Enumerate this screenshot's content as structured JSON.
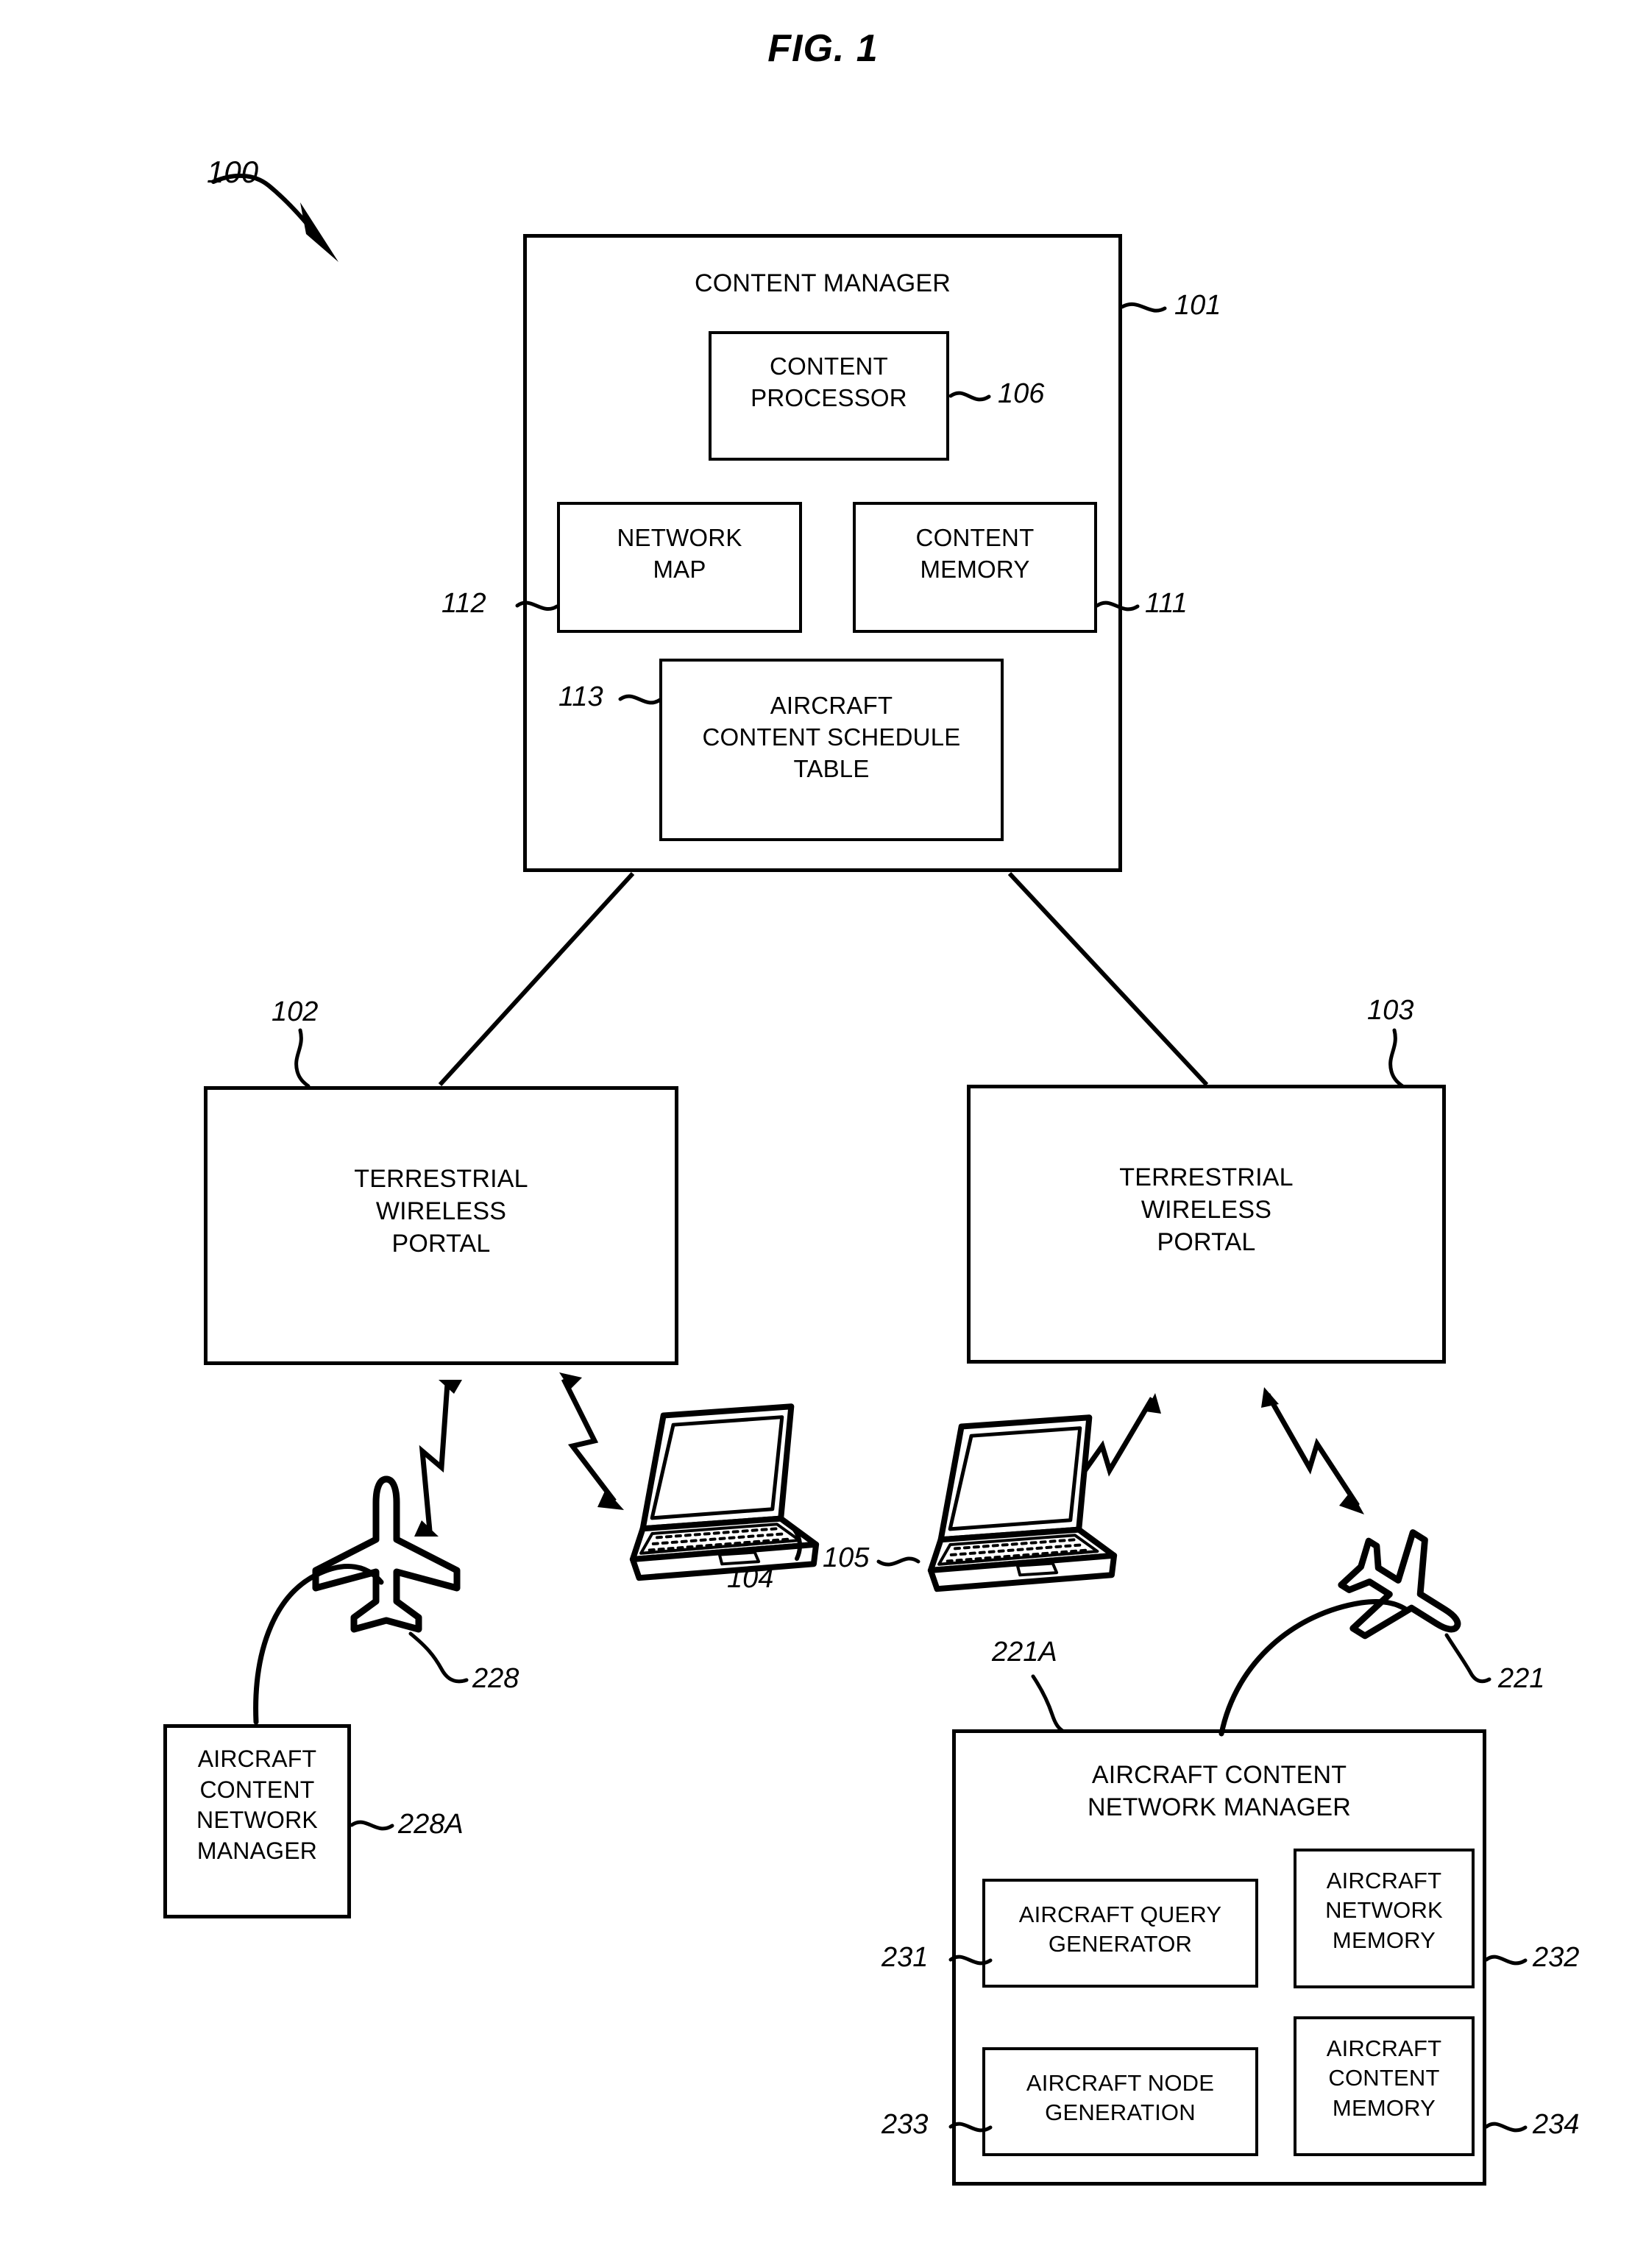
{
  "figure": {
    "title": "FIG. 1",
    "system_ref": "100"
  },
  "blocks": {
    "content_manager": {
      "label": "CONTENT MANAGER",
      "ref": "101",
      "children": {
        "content_processor": {
          "label": "CONTENT\nPROCESSOR",
          "ref": "106"
        },
        "network_map": {
          "label": "NETWORK\nMAP",
          "ref": "112"
        },
        "content_memory": {
          "label": "CONTENT\nMEMORY",
          "ref": "111"
        },
        "aircraft_content_schedule_table": {
          "label": "AIRCRAFT\nCONTENT SCHEDULE\nTABLE",
          "ref": "113"
        }
      }
    },
    "terrestrial_wireless_portal_left": {
      "label": "TERRESTRIAL\nWIRELESS\nPORTAL",
      "ref": "102"
    },
    "terrestrial_wireless_portal_right": {
      "label": "TERRESTRIAL\nWIRELESS\nPORTAL",
      "ref": "103"
    },
    "aircraft_content_network_manager_left": {
      "label": "AIRCRAFT\nCONTENT\nNETWORK\nMANAGER",
      "ref": "228A"
    },
    "aircraft_content_network_manager_right": {
      "label": "AIRCRAFT CONTENT\nNETWORK MANAGER",
      "ref": "221A",
      "children": {
        "aircraft_query_generator": {
          "label": "AIRCRAFT QUERY\nGENERATOR",
          "ref": "231"
        },
        "aircraft_network_memory": {
          "label": "AIRCRAFT\nNETWORK\nMEMORY",
          "ref": "232"
        },
        "aircraft_node_generation": {
          "label": "AIRCRAFT NODE\nGENERATION",
          "ref": "233"
        },
        "aircraft_content_memory": {
          "label": "AIRCRAFT\nCONTENT\nMEMORY",
          "ref": "234"
        }
      }
    }
  },
  "icons": {
    "laptop_left": {
      "name": "laptop-icon",
      "ref": "104"
    },
    "laptop_right": {
      "name": "laptop-icon",
      "ref": "105"
    },
    "aircraft_left": {
      "name": "aircraft-icon",
      "ref": "228"
    },
    "aircraft_right": {
      "name": "aircraft-icon",
      "ref": "221"
    }
  },
  "colors": {
    "line": "#000000",
    "background": "#ffffff"
  }
}
